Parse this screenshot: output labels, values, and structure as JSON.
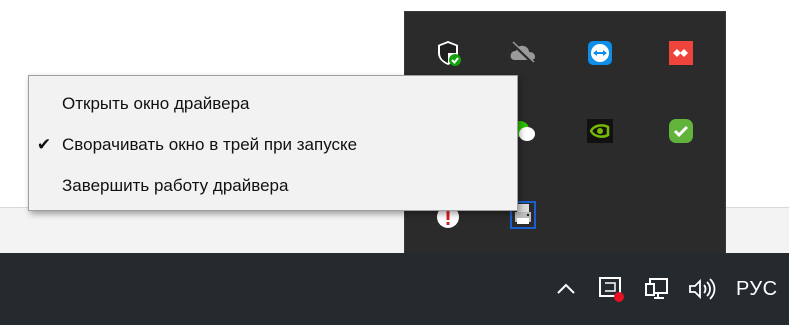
{
  "context_menu": {
    "items": [
      {
        "label": "Открыть окно драйвера",
        "checked": false
      },
      {
        "label": "Сворачивать окно в трей при запуске",
        "checked": true
      },
      {
        "label": "Завершить работу драйвера",
        "checked": false
      }
    ],
    "check_glyph": "✔"
  },
  "tray_icons": [
    {
      "name": "windows-security-icon",
      "color": "#ffffff"
    },
    {
      "name": "onedrive-offline-icon",
      "color": "#9a9a9a"
    },
    {
      "name": "teamviewer-icon",
      "color": "#0e8ee9"
    },
    {
      "name": "anydesk-icon",
      "color": "#ef443b"
    },
    {
      "name": "wechat-icon",
      "color": "#2dc100"
    },
    {
      "name": "nvidia-icon",
      "color": "#76b900"
    },
    {
      "name": "green-check-icon",
      "color": "#62b33b"
    },
    {
      "name": "red-exclamation-icon",
      "color": "#e02020"
    },
    {
      "name": "printer-driver-icon",
      "color": "#1a5fd0"
    }
  ],
  "taskbar": {
    "language": "РУС",
    "icons": [
      "chevron-up-icon",
      "app-status-icon",
      "network-icon",
      "volume-icon"
    ],
    "status_dot_color": "#e81123"
  }
}
